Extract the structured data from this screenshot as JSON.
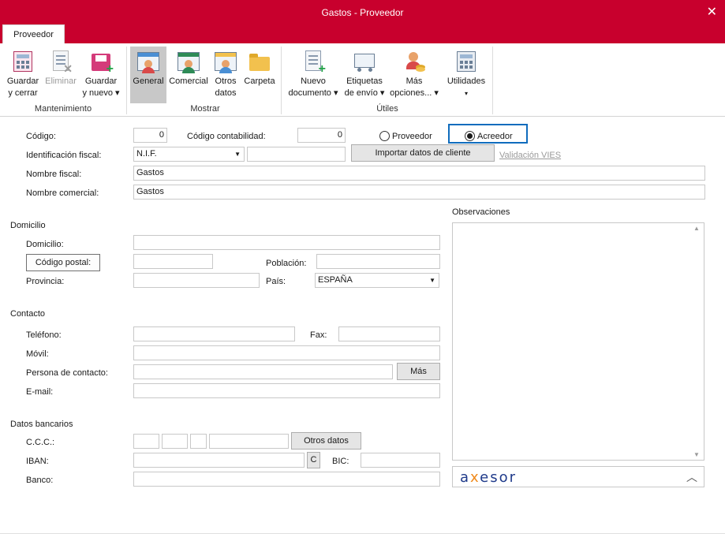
{
  "window": {
    "title": "Gastos - Proveedor",
    "close_icon": "close-icon"
  },
  "tabs": [
    {
      "label": "Proveedor",
      "active": true
    }
  ],
  "ribbon": {
    "buttons": {
      "guardar_cerrar": {
        "line1": "Guardar",
        "line2": "y cerrar"
      },
      "eliminar": {
        "line1": "Eliminar",
        "line2": ""
      },
      "guardar_nuevo": {
        "line1": "Guardar",
        "line2": "y nuevo ▾"
      },
      "general": {
        "line1": "General"
      },
      "comercial": {
        "line1": "Comercial"
      },
      "otros_datos": {
        "line1": "Otros",
        "line2": "datos"
      },
      "carpeta": {
        "line1": "Carpeta"
      },
      "nuevo_documento": {
        "line1": "Nuevo",
        "line2": "documento ▾"
      },
      "etiquetas": {
        "line1": "Etiquetas",
        "line2": "de envío ▾"
      },
      "mas_opciones": {
        "line1": "Más",
        "line2": "opciones... ▾"
      },
      "utilidades": {
        "line1": "Utilidades",
        "line2": "▾"
      }
    },
    "groups": {
      "mantenimiento": "Mantenimiento",
      "mostrar": "Mostrar",
      "utiles": "Útiles"
    }
  },
  "form": {
    "codigo": {
      "label": "Código:",
      "value": "0"
    },
    "codigo_contabilidad": {
      "label": "Código contabilidad:",
      "value": "0"
    },
    "tipo": {
      "proveedor": "Proveedor",
      "acreedor": "Acreedor",
      "selected": "Acreedor"
    },
    "identificacion_fiscal": {
      "label": "Identificación fiscal:",
      "tipo": "N.I.F.",
      "value": ""
    },
    "importar_button": "Importar datos de cliente",
    "validacion_vies": "Validación VIES",
    "nombre_fiscal": {
      "label": "Nombre fiscal:",
      "value": "Gastos"
    },
    "nombre_comercial": {
      "label": "Nombre comercial:",
      "value": "Gastos"
    },
    "domicilio_section": "Domicilio",
    "domicilio": {
      "label": "Domicilio:",
      "value": ""
    },
    "codigo_postal_button": "Código postal:",
    "poblacion": {
      "label": "Población:",
      "value": ""
    },
    "provincia": {
      "label": "Provincia:",
      "value": ""
    },
    "pais": {
      "label": "País:",
      "value": "ESPAÑA"
    },
    "contacto_section": "Contacto",
    "telefono": {
      "label": "Teléfono:",
      "value": ""
    },
    "fax": {
      "label": "Fax:",
      "value": ""
    },
    "movil": {
      "label": "Móvil:",
      "value": ""
    },
    "persona_contacto": {
      "label": "Persona de contacto:",
      "value": ""
    },
    "mas_button": "Más",
    "email": {
      "label": "E-mail:",
      "value": ""
    },
    "bancarios_section": "Datos bancarios",
    "ccc": {
      "label": "C.C.C.:"
    },
    "otros_datos_button": "Otros datos",
    "iban": {
      "label": "IBAN:",
      "c_button": "C"
    },
    "bic": {
      "label": "BIC:"
    },
    "banco": {
      "label": "Banco:"
    }
  },
  "observaciones": {
    "label": "Observaciones",
    "value": ""
  },
  "axesor": {
    "logo_a": "a",
    "logo_x": "x",
    "logo_rest": "esor"
  },
  "colors": {
    "accent": "#c8002d",
    "focus_border": "#0f6cbd"
  }
}
